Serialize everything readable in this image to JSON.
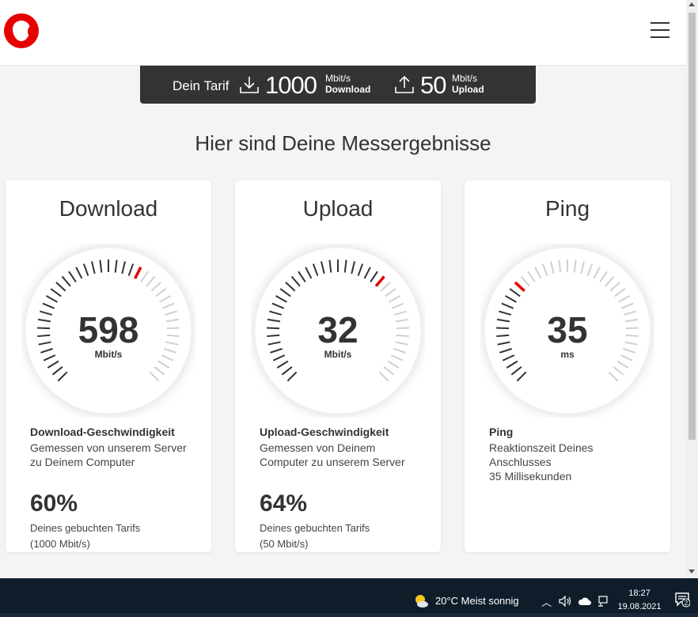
{
  "tariff": {
    "label": "Dein Tarif",
    "download_value": "1000",
    "download_unit": "Mbit/s",
    "download_label": "Download",
    "upload_value": "50",
    "upload_unit": "Mbit/s",
    "upload_label": "Upload"
  },
  "page_title": "Hier sind Deine Messergebnisse",
  "cards": [
    {
      "title": "Download",
      "value": "598",
      "unit": "Mbit/s",
      "gauge_level": 0.6,
      "heading": "Download-Geschwindigkeit",
      "description": "Gemessen von unserem Server zu Deinem Computer",
      "percent": "60%",
      "note": "Deines gebuchten Tarifs",
      "note_detail": "(1000 Mbit/s)"
    },
    {
      "title": "Upload",
      "value": "32",
      "unit": "Mbit/s",
      "gauge_level": 0.64,
      "heading": "Upload-Geschwindigkeit",
      "description": "Gemessen von Deinem Computer zu unserem Server",
      "percent": "64%",
      "note": "Deines gebuchten Tarifs",
      "note_detail": "(50 Mbit/s)"
    },
    {
      "title": "Ping",
      "value": "35",
      "unit": "ms",
      "gauge_level": 0.33,
      "heading": "Ping",
      "description": "Reaktionszeit Deines Anschlusses",
      "description_extra": "35 Millisekunden"
    }
  ],
  "taskbar": {
    "weather": "20°C  Meist sonnig",
    "time": "18:27",
    "date": "19.08.2021",
    "notification_count": "2"
  },
  "colors": {
    "brand": "#e60000",
    "dark": "#333333",
    "tick_active": "#333333",
    "tick_inactive": "#d0d0d0",
    "taskbar": "#0f1d2b"
  }
}
